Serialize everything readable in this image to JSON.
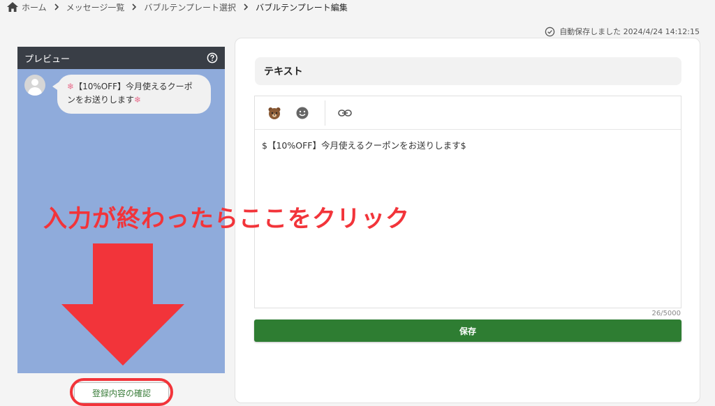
{
  "breadcrumb": {
    "items": [
      "ホーム",
      "メッセージ一覧",
      "バブルテンプレート選択"
    ],
    "current": "バブルテンプレート編集"
  },
  "autosave": {
    "text": "自動保存しました 2024/4/24 14:12:15"
  },
  "preview": {
    "title": "プレビュー",
    "message_prefix": "❄",
    "message_line1": "【10%OFF】今月使えるクーポ",
    "message_line2": "ンをお送りします",
    "message_suffix": "❄",
    "confirm_label": "登録内容の確認"
  },
  "editor": {
    "section_title": "テキスト",
    "content": "$【10%OFF】今月使えるクーポンをお送りします$",
    "counter": "26/5000",
    "save_label": "保存"
  },
  "annotation": {
    "text": "入力が終わったらここをクリック"
  },
  "colors": {
    "accent_red": "#f2343a",
    "save_green": "#2e7d32",
    "preview_bg": "#8fabdb"
  }
}
